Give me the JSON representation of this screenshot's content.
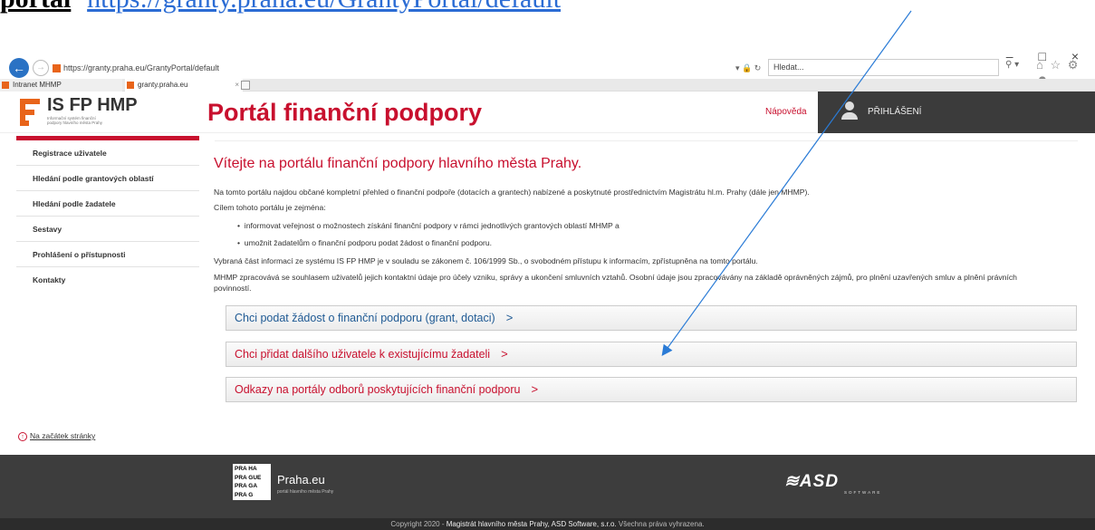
{
  "doc": {
    "label": "portal",
    "url": "https://granty.praha.eu/GrantyPortal/default"
  },
  "browser": {
    "address": "https://granty.praha.eu/GrantyPortal/default",
    "search_placeholder": "Hledat...",
    "tabs": [
      {
        "label": "Intranet MHMP"
      },
      {
        "label": "granty.praha.eu"
      }
    ]
  },
  "header": {
    "logo_title": "IS FP HMP",
    "logo_subtitle": "Informační systém finanční podpory hlavního města Prahy",
    "portal_title": "Portál finanční podpory",
    "help": "Nápověda",
    "login": "PŘIHLÁŠENÍ"
  },
  "sidebar": {
    "items": [
      {
        "label": "Registrace uživatele"
      },
      {
        "label": "Hledání podle grantových oblastí"
      },
      {
        "label": "Hledání podle žadatele"
      },
      {
        "label": "Sestavy"
      },
      {
        "label": "Prohlášení o přístupnosti"
      },
      {
        "label": "Kontakty"
      }
    ]
  },
  "main": {
    "welcome": "Vítejte na portálu finanční podpory hlavního města Prahy.",
    "p1": "Na tomto portálu najdou občané kompletní přehled o finanční podpoře (dotacích a grantech) nabízené a poskytnuté prostřednictvím Magistrátu hl.m. Prahy (dále jen MHMP).",
    "p2": "Cílem tohoto portálu je zejména:",
    "bullets": [
      "informovat veřejnost o možnostech získání finanční podpory v rámci jednotlivých grantových oblastí MHMP a",
      "umožnit žadatelům o finanční podporu podat žádost o finanční podporu."
    ],
    "p3": "Vybraná část informací ze systému IS FP HMP je v souladu se zákonem č. 106/1999 Sb., o svobodném přístupu k informacím, zpřístupněna na tomto portálu.",
    "p4a": "MHMP zpracovává se souhlasem uživatelů jejich kontaktní údaje pro účely vzniku, správy a ukončení smluvních vztahů. Osobní údaje jsou zpracovávány na základě oprávněných zájmů, pro plnění uzavřených smluv a plnění právních",
    "p4b": "povinností.",
    "actions": [
      {
        "label": "Chci podat žádost o finanční podporu (grant, dotaci)"
      },
      {
        "label": "Chci přidat dalšího uživatele k existujícímu žadateli"
      },
      {
        "label": "Odkazy na portály odborů poskytujících finanční podporu"
      }
    ],
    "chevron": ">"
  },
  "back_to_top": "Na začátek stránky",
  "footer": {
    "praha_logo_lines": [
      "PRA HA",
      "PRA GUE",
      "PRA GA",
      "PRA G"
    ],
    "praha_name": "Praha.eu",
    "praha_sub": "portál hlavního města Prahy",
    "asd": "ASD",
    "asd_sub": "SOFTWARE",
    "copyright_pre": "Copyright 2020 - ",
    "copyright_mid": "Magistrát hlavního města Prahy, ASD Software, s.r.o.",
    "copyright_post": " Všechna práva vyhrazena."
  },
  "colors": {
    "brand_red": "#c8102e",
    "brand_orange": "#e8641a",
    "link_blue": "#1f5a94",
    "annotation": "#2a7bd6"
  }
}
